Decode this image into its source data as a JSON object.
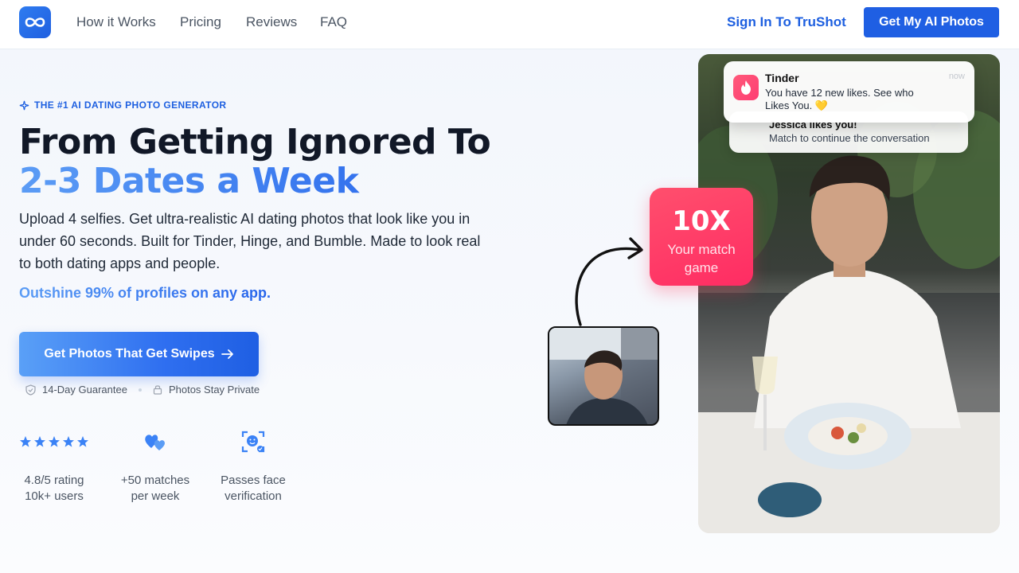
{
  "nav": {
    "links": [
      "How it Works",
      "Pricing",
      "Reviews",
      "FAQ"
    ],
    "signin": "Sign In To TruShot",
    "cta": "Get My AI Photos"
  },
  "hero": {
    "eyebrow": "THE #1 AI DATING PHOTO GENERATOR",
    "title_line1": "From Getting Ignored To",
    "title_line2": "2-3 Dates a Week",
    "description": "Upload 4 selfies. Get ultra-realistic AI dating photos that look like you in under 60 seconds. Built for Tinder, Hinge, and Bumble. Made to look real to both dating apps and people.",
    "highlight": "Outshine 99% of profiles on any app.",
    "cta": "Get Photos That Get Swipes",
    "trust": [
      "14-Day Guarantee",
      "Photos Stay Private"
    ]
  },
  "stats": [
    {
      "icon": "stars-icon",
      "line1": "4.8/5 rating",
      "line2": "10k+ users",
      "stars": 5
    },
    {
      "icon": "hearts-icon",
      "line1": "+50 matches",
      "line2": "per week"
    },
    {
      "icon": "face-scan-icon",
      "line1": "Passes face",
      "line2": "verification"
    }
  ],
  "visual": {
    "notification": {
      "app": "Tinder",
      "time": "now",
      "message": "You have 12 new likes. See who Likes You. 💛"
    },
    "notification_back": {
      "title": "Jessica likes you!",
      "message": "Match to continue the conversation"
    },
    "badge": {
      "big": "10X",
      "small": "Your match game"
    }
  },
  "colors": {
    "brand": "#1f5fe3",
    "accent": "#3b82f6",
    "badge": "#ff3d68"
  }
}
